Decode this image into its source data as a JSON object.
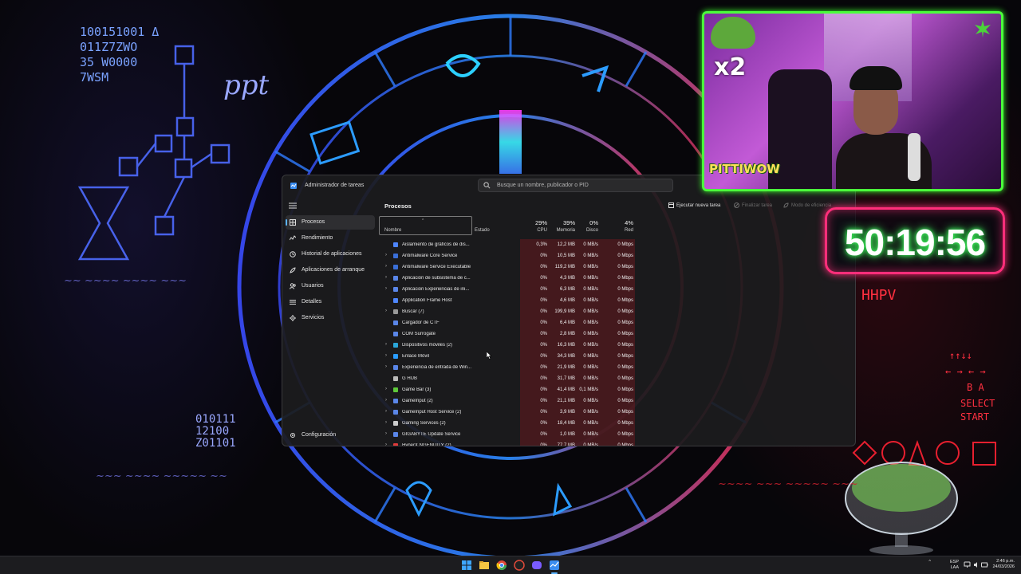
{
  "task_manager": {
    "app_title": "Administrador de tareas",
    "search_placeholder": "Busque un nombre, publicador o PID",
    "nav": [
      {
        "label": "Procesos",
        "icon": "processes-grid-icon"
      },
      {
        "label": "Rendimiento",
        "icon": "performance-chart-icon"
      },
      {
        "label": "Historial de aplicaciones",
        "icon": "history-icon"
      },
      {
        "label": "Aplicaciones de arranque",
        "icon": "startup-icon"
      },
      {
        "label": "Usuarios",
        "icon": "users-icon"
      },
      {
        "label": "Detalles",
        "icon": "details-list-icon"
      },
      {
        "label": "Servicios",
        "icon": "services-gear-icon"
      }
    ],
    "settings_label": "Configuración",
    "page_title": "Procesos",
    "toolbar": {
      "run_new_task": "Ejecutar nueva tarea",
      "end_task": "Finalizar tarea",
      "efficiency_mode": "Modo de eficiencia"
    },
    "columns": {
      "name": "Nombre",
      "status": "Estado",
      "cpu_pct": "29%",
      "cpu": "CPU",
      "mem_pct": "39%",
      "mem": "Memoria",
      "disk_pct": "0%",
      "disk": "Disco",
      "net_pct": "4%",
      "net": "Red"
    },
    "processes": [
      {
        "name": "Aislamiento de gráficos de dis...",
        "expand": "",
        "cpu": "0,3%",
        "mem": "12,2 MB",
        "disk": "0 MB/s",
        "net": "0 Mbps"
      },
      {
        "name": "Antimalware Core Service",
        "expand": "›",
        "cpu": "0%",
        "mem": "10,5 MB",
        "disk": "0 MB/s",
        "net": "0 Mbps"
      },
      {
        "name": "Antimalware Service Executable",
        "expand": "›",
        "cpu": "0%",
        "mem": "119,2 MB",
        "disk": "0 MB/s",
        "net": "0 Mbps"
      },
      {
        "name": "Aplicación de subsistema de c...",
        "expand": "›",
        "cpu": "0%",
        "mem": "4,3 MB",
        "disk": "0 MB/s",
        "net": "0 Mbps"
      },
      {
        "name": "Aplicación Experiencias de ini...",
        "expand": "›",
        "cpu": "0%",
        "mem": "6,3 MB",
        "disk": "0 MB/s",
        "net": "0 Mbps"
      },
      {
        "name": "Application Frame Host",
        "expand": "",
        "cpu": "0%",
        "mem": "4,6 MB",
        "disk": "0 MB/s",
        "net": "0 Mbps"
      },
      {
        "name": "Buscar (7)",
        "expand": "›",
        "cpu": "0%",
        "mem": "199,9 MB",
        "disk": "0 MB/s",
        "net": "0 Mbps"
      },
      {
        "name": "Cargador de CTF",
        "expand": "",
        "cpu": "0%",
        "mem": "6,4 MB",
        "disk": "0 MB/s",
        "net": "0 Mbps"
      },
      {
        "name": "COM Surrogate",
        "expand": "",
        "cpu": "0%",
        "mem": "2,8 MB",
        "disk": "0 MB/s",
        "net": "0 Mbps"
      },
      {
        "name": "Dispositivos móviles (2)",
        "expand": "›",
        "cpu": "0%",
        "mem": "16,3 MB",
        "disk": "0 MB/s",
        "net": "0 Mbps"
      },
      {
        "name": "Enlace Móvil",
        "expand": "›",
        "cpu": "0%",
        "mem": "34,3 MB",
        "disk": "0 MB/s",
        "net": "0 Mbps"
      },
      {
        "name": "Experiencia de entrada de Win...",
        "expand": "›",
        "cpu": "0%",
        "mem": "21,9 MB",
        "disk": "0 MB/s",
        "net": "0 Mbps"
      },
      {
        "name": "G HUB",
        "expand": "",
        "cpu": "0%",
        "mem": "31,7 MB",
        "disk": "0 MB/s",
        "net": "0 Mbps"
      },
      {
        "name": "Game Bar (3)",
        "expand": "›",
        "cpu": "0%",
        "mem": "41,4 MB",
        "disk": "0,1 MB/s",
        "net": "0 Mbps"
      },
      {
        "name": "GameInput (2)",
        "expand": "›",
        "cpu": "0%",
        "mem": "21,1 MB",
        "disk": "0 MB/s",
        "net": "0 Mbps"
      },
      {
        "name": "GameInput Host Service (2)",
        "expand": "›",
        "cpu": "0%",
        "mem": "3,9 MB",
        "disk": "0 MB/s",
        "net": "0 Mbps"
      },
      {
        "name": "Gaming Services (2)",
        "expand": "›",
        "cpu": "0%",
        "mem": "18,4 MB",
        "disk": "0 MB/s",
        "net": "0 Mbps"
      },
      {
        "name": "GIGABYTE Update Service",
        "expand": "›",
        "cpu": "0%",
        "mem": "1,0 MB",
        "disk": "0 MB/s",
        "net": "0 Mbps"
      },
      {
        "name": "HyperX NGENUITY (2)",
        "expand": "›",
        "cpu": "0%",
        "mem": "77,7 MB",
        "disk": "0 MB/s",
        "net": "0 Mbps"
      }
    ]
  },
  "overlay": {
    "timer": "50:19:56",
    "cam_multiplier": "x2",
    "cam_brand": "PITTIWOW"
  },
  "taskbar": {
    "lang_top": "ESP",
    "lang_bottom": "LAA",
    "time": "2:46 p.m.",
    "date": "24/03/2026"
  },
  "colors": {
    "accent": "#5cb3ff",
    "heat_column": "#781820",
    "timer_border": "#ff2e7a",
    "timer_glow": "#3cff5c",
    "cam_border": "#4bff3c"
  }
}
